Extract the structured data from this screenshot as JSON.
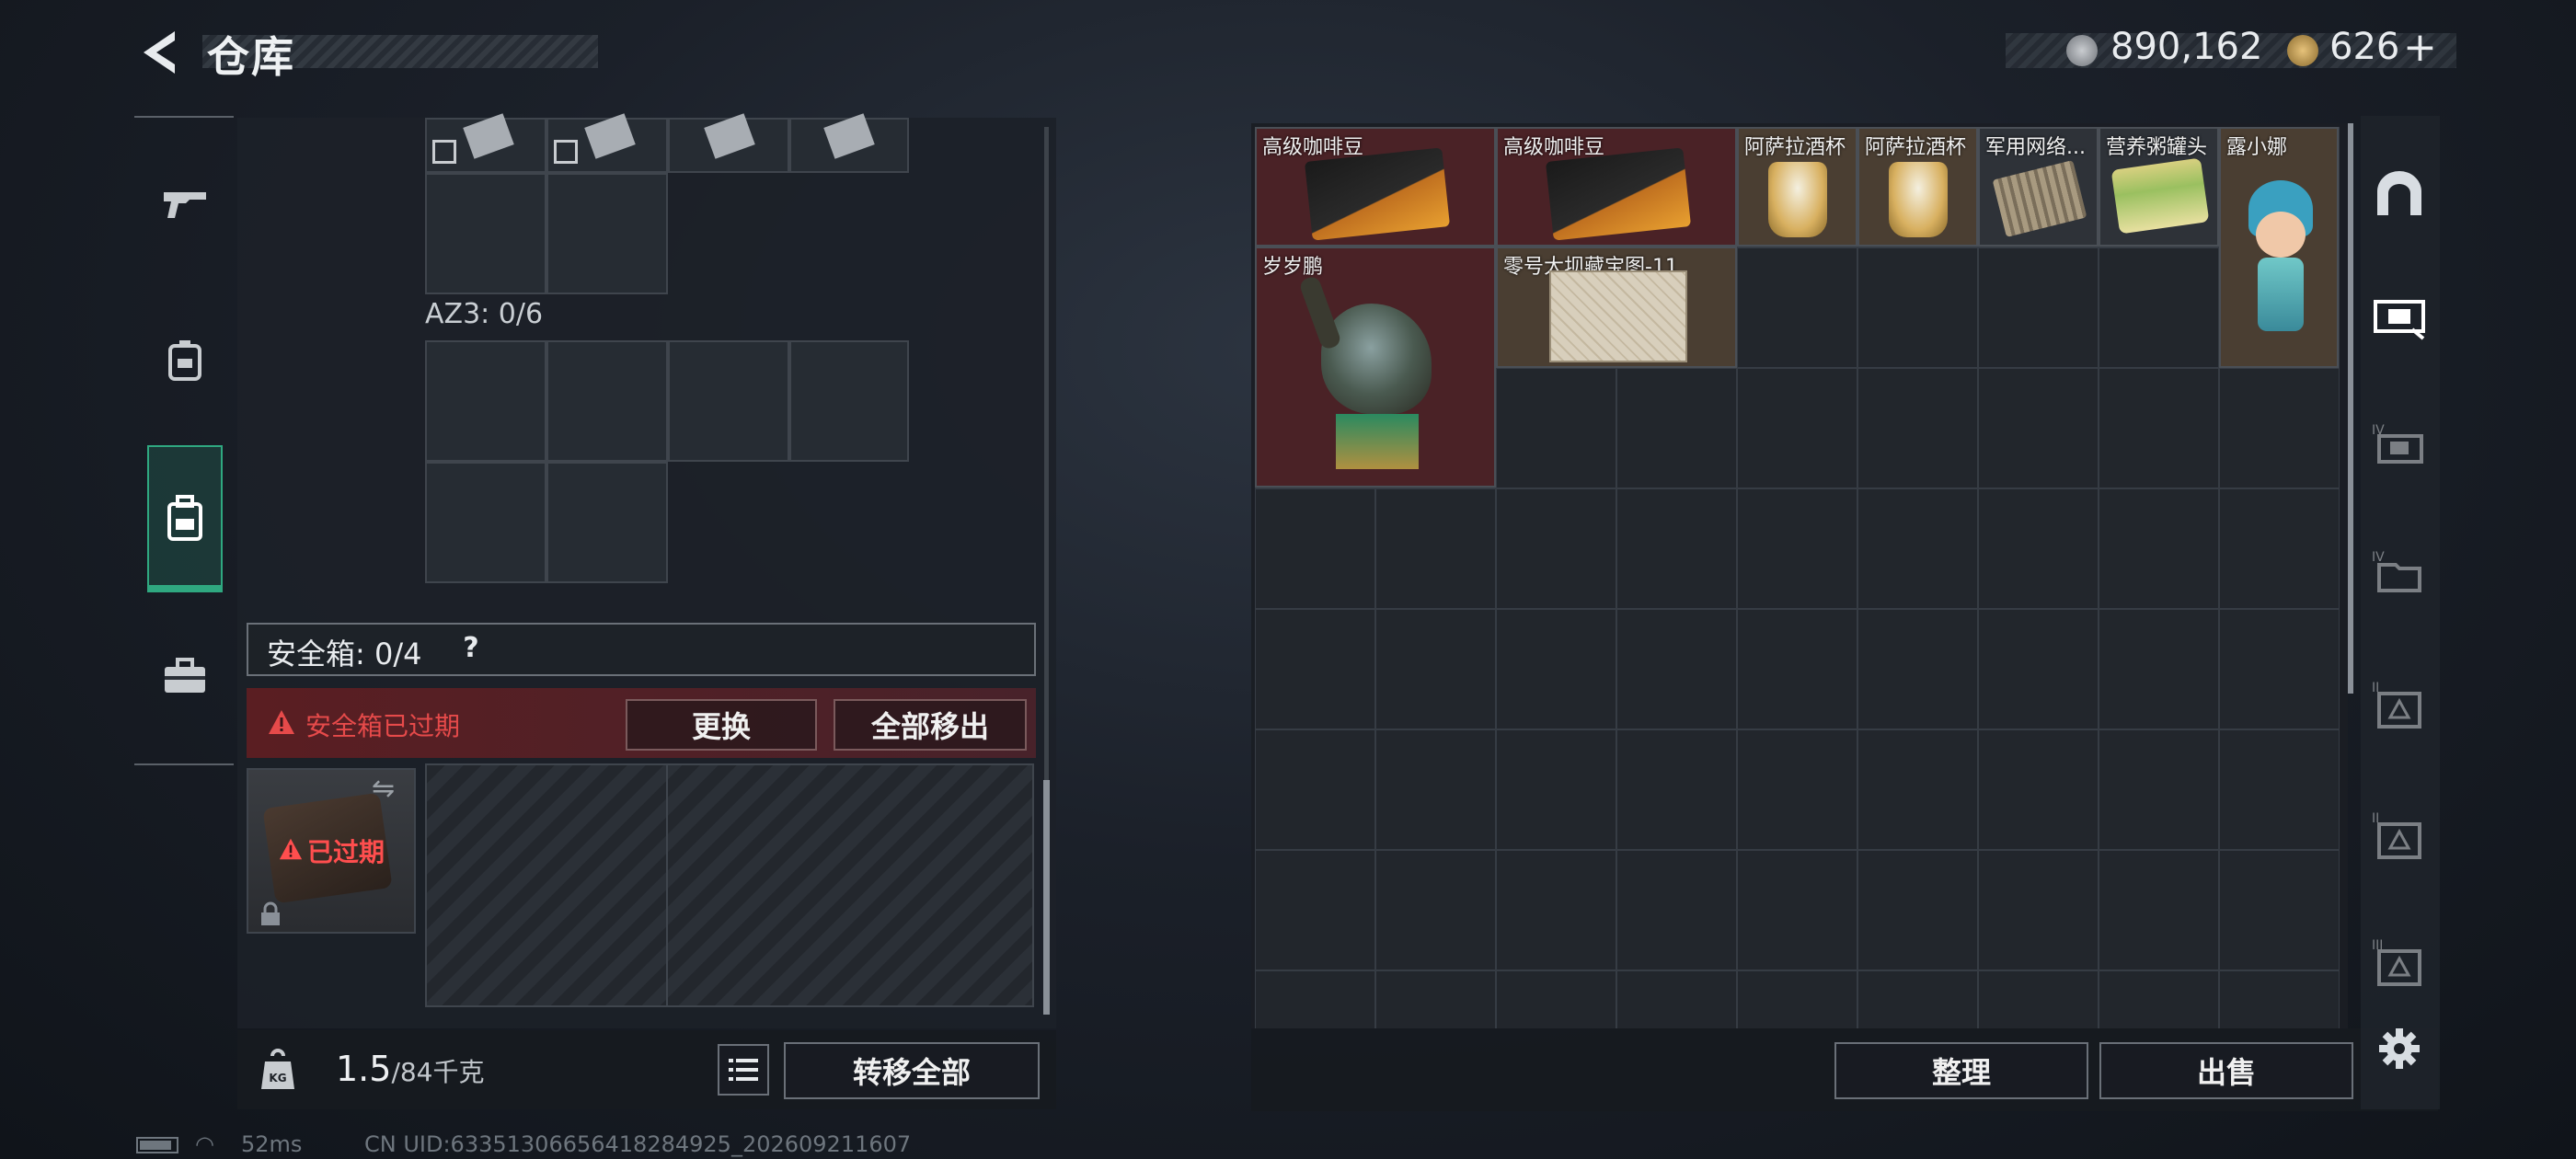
{
  "header": {
    "title": "仓库"
  },
  "currency": {
    "silver": "890,162",
    "gold": "626",
    "plus": "+"
  },
  "left_tabs": [
    {
      "name": "weapons",
      "active": false
    },
    {
      "name": "equipment",
      "active": false
    },
    {
      "name": "backpack",
      "active": true
    },
    {
      "name": "toolbox",
      "active": false
    }
  ],
  "container": {
    "az3_label": "AZ3: 0/6"
  },
  "safe_box": {
    "label": "安全箱:  0/4",
    "help": "?",
    "warning": "安全箱已过期",
    "replace_button": "更换",
    "remove_all_button": "全部移出",
    "expired_badge": "已过期"
  },
  "bottom_left": {
    "weight_value": "1.5",
    "weight_capacity": "/84千克",
    "transfer_all_button": "转移全部"
  },
  "stash_items": [
    {
      "name": "高级咖啡豆",
      "bg": "red"
    },
    {
      "name": "高级咖啡豆",
      "bg": "red"
    },
    {
      "name": "阿萨拉酒杯",
      "bg": "gold"
    },
    {
      "name": "阿萨拉酒杯",
      "bg": "gold"
    },
    {
      "name": "军用网络...",
      "bg": "dark"
    },
    {
      "name": "营养粥罐头",
      "bg": "dark"
    },
    {
      "name": "露小娜",
      "bg": "gold"
    },
    {
      "name": "岁岁鹏",
      "bg": "red"
    },
    {
      "name": "零号大坝藏宝图-11",
      "bg": "gold"
    }
  ],
  "bottom_right": {
    "sort_button": "整理",
    "sell_button": "出售"
  },
  "footer": {
    "ping": "52ms",
    "uid": "CN UID:633513066564182849​25_202609211607"
  },
  "colors": {
    "accent_green": "#2fa880",
    "warning_red": "#e64a4a",
    "item_red": "#4a2226",
    "item_gold": "#4a3e32"
  }
}
